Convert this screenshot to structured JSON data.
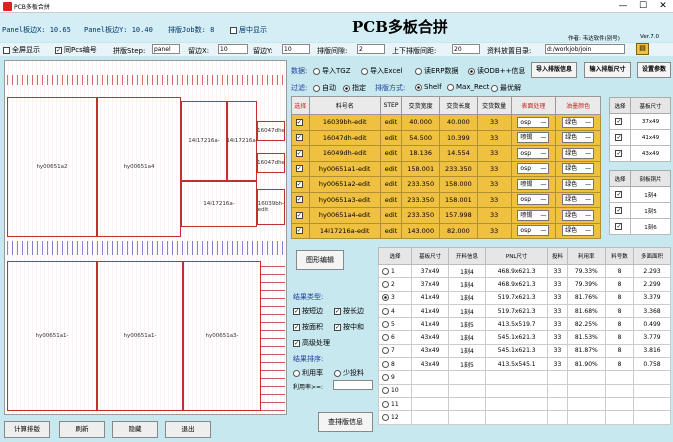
{
  "window": {
    "title": "PCB多板合拼",
    "min": "—",
    "max": "☐",
    "close": "✕"
  },
  "header": {
    "panel_x": "Panel板边X: 10.65",
    "panel_y": "Panel板边Y: 10.40",
    "job_count": "排版Job数: 8",
    "center_show": "居中显示",
    "title": "PCB多板合拼",
    "author": "作者: 韦达软件(别号)",
    "version": "Ver.7.0"
  },
  "options": {
    "full_show": "全屏显示",
    "same_pcs": "同Pcs编号",
    "step_label": "拼版Step:",
    "step_val": "panel",
    "margin_x_label": "留边X:",
    "margin_x_val": "10",
    "margin_y_label": "留边Y:",
    "margin_y_val": "10",
    "gap_label": "排版间隙:",
    "gap_val": "2",
    "ud_gap_label": "上下排版间距:",
    "ud_gap_val": "20",
    "dir_label": "资料放置目录:",
    "dir_val": "d:/workjob/join",
    "folder_icon": "folder-icon"
  },
  "data_row": {
    "label": "数据:",
    "opt1": "导入TGZ",
    "opt2": "导入Excel",
    "opt3": "读ERP数据",
    "opt4": "读ODB++信息",
    "btn_import": "导入排版信息",
    "btn_size": "输入排版尺寸",
    "btn_param": "设置参数"
  },
  "filter_row": {
    "label": "过滤:",
    "opt1": "自动",
    "opt2": "指定",
    "method_label": "排版方式:",
    "opt3": "Shelf",
    "opt4": "Max_Rect",
    "opt5": "最优解"
  },
  "top_table": {
    "headers": [
      "选择",
      "料号名",
      "STEP",
      "交货宽度",
      "交货长度",
      "交货数量",
      "表面处理",
      "油墨颜色"
    ],
    "rows": [
      {
        "name": "16039bh-edit",
        "step": "edit",
        "w": "40.000",
        "l": "40.000",
        "q": "33",
        "surf": "osp",
        "ink": "绿色"
      },
      {
        "name": "16047dh-edit",
        "step": "edit",
        "w": "54.500",
        "l": "10.399",
        "q": "33",
        "surf": "喷锡",
        "ink": "绿色"
      },
      {
        "name": "16049dh-edit",
        "step": "edit",
        "w": "18.136",
        "l": "14.554",
        "q": "33",
        "surf": "osp",
        "ink": "绿色"
      },
      {
        "name": "hy00651a1-edit",
        "step": "edit",
        "w": "158.001",
        "l": "233.350",
        "q": "33",
        "surf": "osp",
        "ink": "绿色"
      },
      {
        "name": "hy00651a2-edit",
        "step": "edit",
        "w": "233.350",
        "l": "158.000",
        "q": "33",
        "surf": "喷锡",
        "ink": "绿色"
      },
      {
        "name": "hy00651a3-edit",
        "step": "edit",
        "w": "233.350",
        "l": "158.001",
        "q": "33",
        "surf": "osp",
        "ink": "绿色"
      },
      {
        "name": "hy00651a4-edit",
        "step": "edit",
        "w": "233.350",
        "l": "157.998",
        "q": "33",
        "surf": "喷锡",
        "ink": "绿色"
      },
      {
        "name": "14i17216a-edit",
        "step": "edit",
        "w": "143.000",
        "l": "82.000",
        "q": "33",
        "surf": "osp",
        "ink": "绿色"
      }
    ]
  },
  "side1": {
    "headers": [
      "选择",
      "基板尺寸"
    ],
    "rows": [
      "37x49",
      "41x49",
      "43x49"
    ]
  },
  "side2": {
    "headers": [
      "选择",
      "刻板铜片"
    ],
    "rows": [
      "1刻4",
      "1刻5",
      "1刻6"
    ]
  },
  "left_panel": {
    "edit_btn": "图形编辑",
    "type_label": "结果类型:",
    "c1": "按短边",
    "c2": "按长边",
    "c3": "按面积",
    "c4": "按中和",
    "c5": "高级处理",
    "sort_label": "结果排序:",
    "s1": "利用率",
    "s2": "少投料",
    "rate_label": "利用率>=:",
    "query_btn": "查排版信息"
  },
  "result_table": {
    "headers": [
      "选择",
      "基板尺寸",
      "开料信息",
      "PNL尺寸",
      "投料",
      "利用率",
      "料号数",
      "多面面积"
    ],
    "rows": [
      {
        "n": "1",
        "size": "37x49",
        "cut": "1刻4",
        "pnl": "468.9x621.3",
        "feed": "33",
        "rate": "79.33%",
        "cnt": "8",
        "area": "2.293"
      },
      {
        "n": "2",
        "size": "37x49",
        "cut": "1刻4",
        "pnl": "468.9x621.3",
        "feed": "33",
        "rate": "79.39%",
        "cnt": "8",
        "area": "2.299"
      },
      {
        "n": "3",
        "size": "41x49",
        "cut": "1刻4",
        "pnl": "519.7x621.3",
        "feed": "33",
        "rate": "81.76%",
        "cnt": "8",
        "area": "3.379"
      },
      {
        "n": "4",
        "size": "41x49",
        "cut": "1刻4",
        "pnl": "519.7x621.3",
        "feed": "33",
        "rate": "81.68%",
        "cnt": "8",
        "area": "3.368"
      },
      {
        "n": "5",
        "size": "41x49",
        "cut": "1刻5",
        "pnl": "413.5x519.7",
        "feed": "33",
        "rate": "82.25%",
        "cnt": "8",
        "area": "0.499"
      },
      {
        "n": "6",
        "size": "43x49",
        "cut": "1刻4",
        "pnl": "545.1x621.3",
        "feed": "33",
        "rate": "81.53%",
        "cnt": "8",
        "area": "3.779"
      },
      {
        "n": "7",
        "size": "43x49",
        "cut": "1刻4",
        "pnl": "545.1x621.3",
        "feed": "33",
        "rate": "81.87%",
        "cnt": "8",
        "area": "3.816"
      },
      {
        "n": "8",
        "size": "43x49",
        "cut": "1刻5",
        "pnl": "413.5x545.1",
        "feed": "33",
        "rate": "81.90%",
        "cnt": "8",
        "area": "0.758"
      },
      {
        "n": "9"
      },
      {
        "n": "10"
      },
      {
        "n": "11"
      },
      {
        "n": "12"
      }
    ]
  },
  "canvas": {
    "labels": [
      "hy00651a2",
      "hy00651a4",
      "14i17216a-",
      "14i17216a-",
      "16047dhe",
      "16047dhe",
      "14i17216a-",
      "16039bh-edit",
      "hy00651a1-",
      "hy00651a1-",
      "hy00651a3-",
      "16039bh-edit"
    ]
  },
  "bottom": {
    "b1": "计算排版",
    "b2": "刷新",
    "b3": "隐藏",
    "b4": "退出"
  }
}
